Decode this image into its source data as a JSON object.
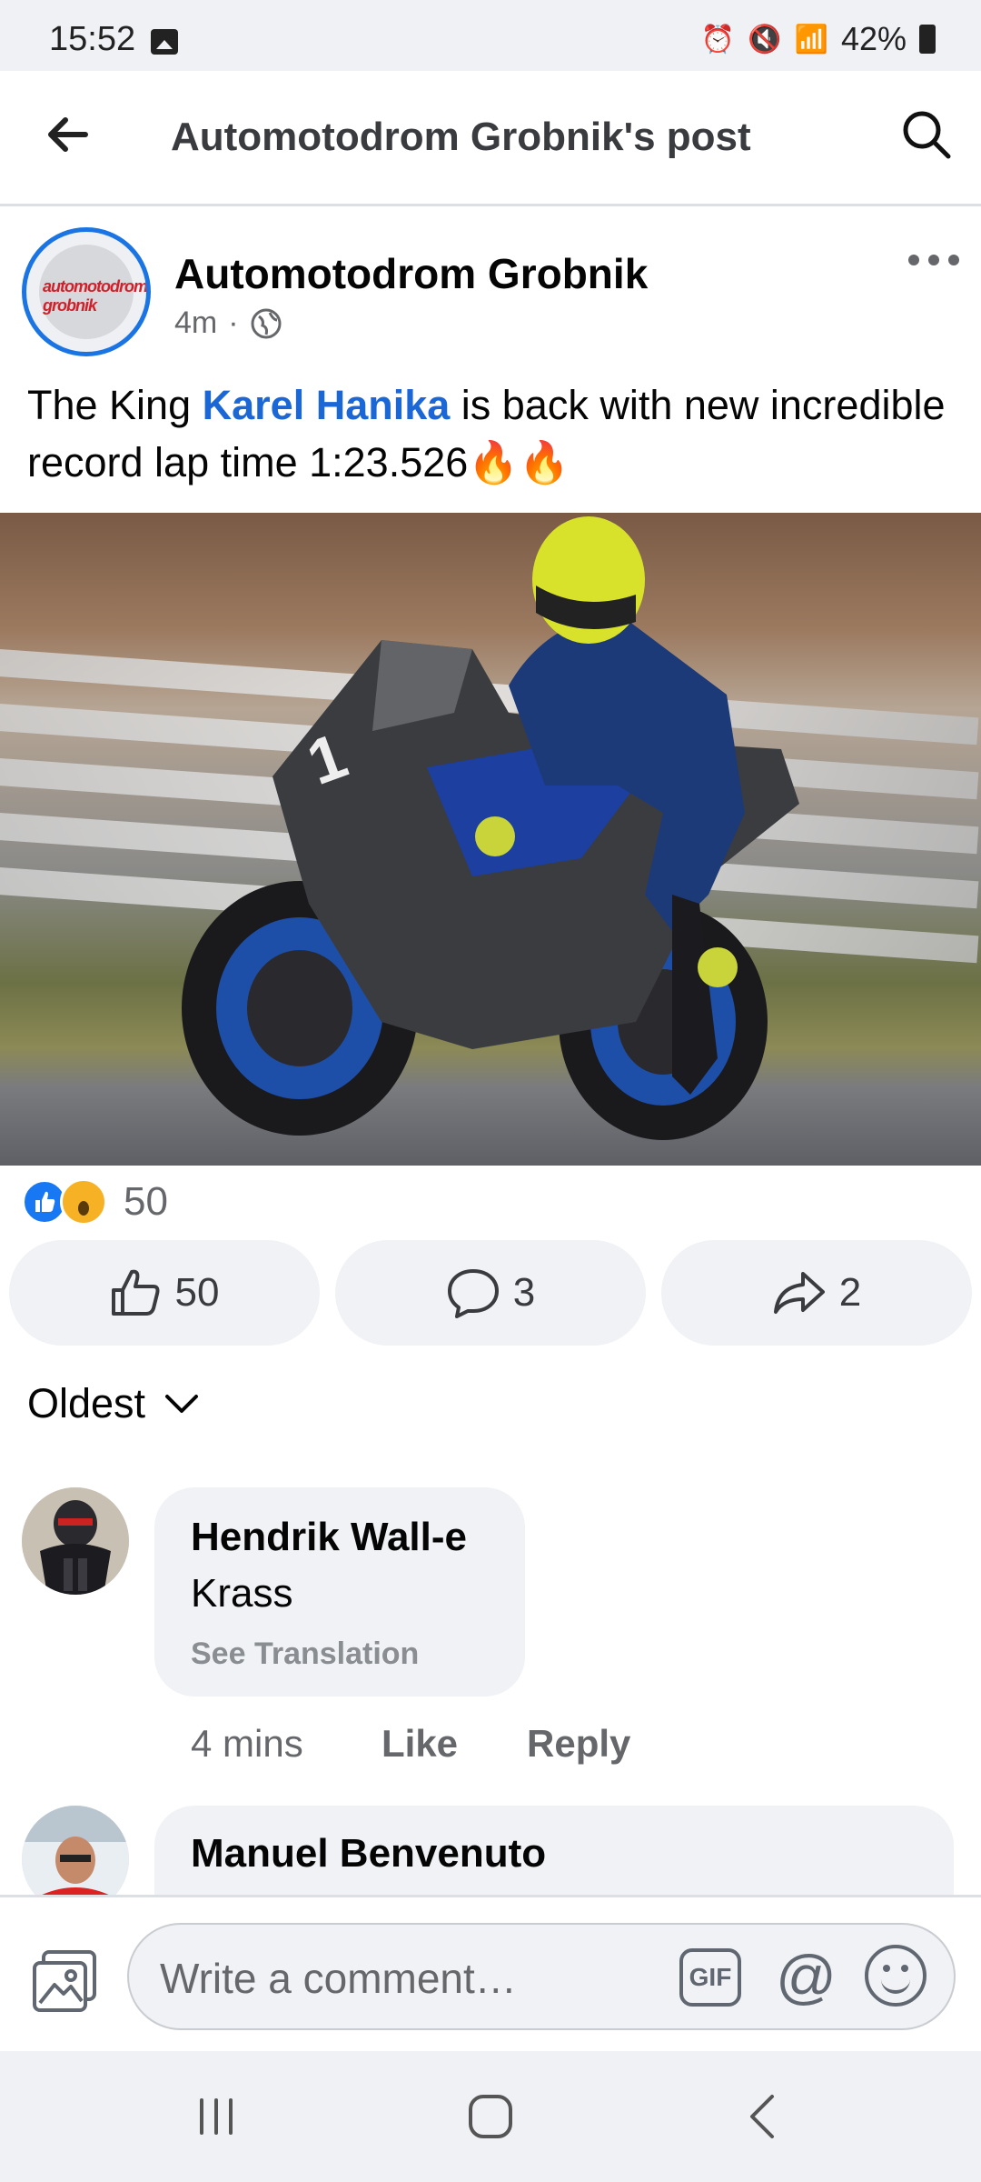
{
  "status_bar": {
    "time": "15:52",
    "battery": "42%"
  },
  "header": {
    "title": "Automotodrom Grobnik's post"
  },
  "post": {
    "page_name": "Automotodrom Grobnik",
    "time": "4m",
    "separator": "·",
    "avatar_logo_text": "automotodrom grobnik",
    "text_prefix": "The King ",
    "mention": "Karel Hanika",
    "text_suffix": " is back with new incredible record lap time 1:23.526",
    "emoji": "🔥🔥",
    "reaction_count": "50",
    "likes": "50",
    "comments": "3",
    "shares": "2"
  },
  "comments_section": {
    "sort_label": "Oldest",
    "comments": [
      {
        "author": "Hendrik Wall-e",
        "text": "Krass",
        "translate": "See Translation",
        "time": "4 mins",
        "like": "Like",
        "reply": "Reply"
      },
      {
        "author": "Manuel Benvenuto"
      }
    ]
  },
  "composer": {
    "placeholder": "Write a comment…",
    "gif": "GIF",
    "at": "@"
  }
}
